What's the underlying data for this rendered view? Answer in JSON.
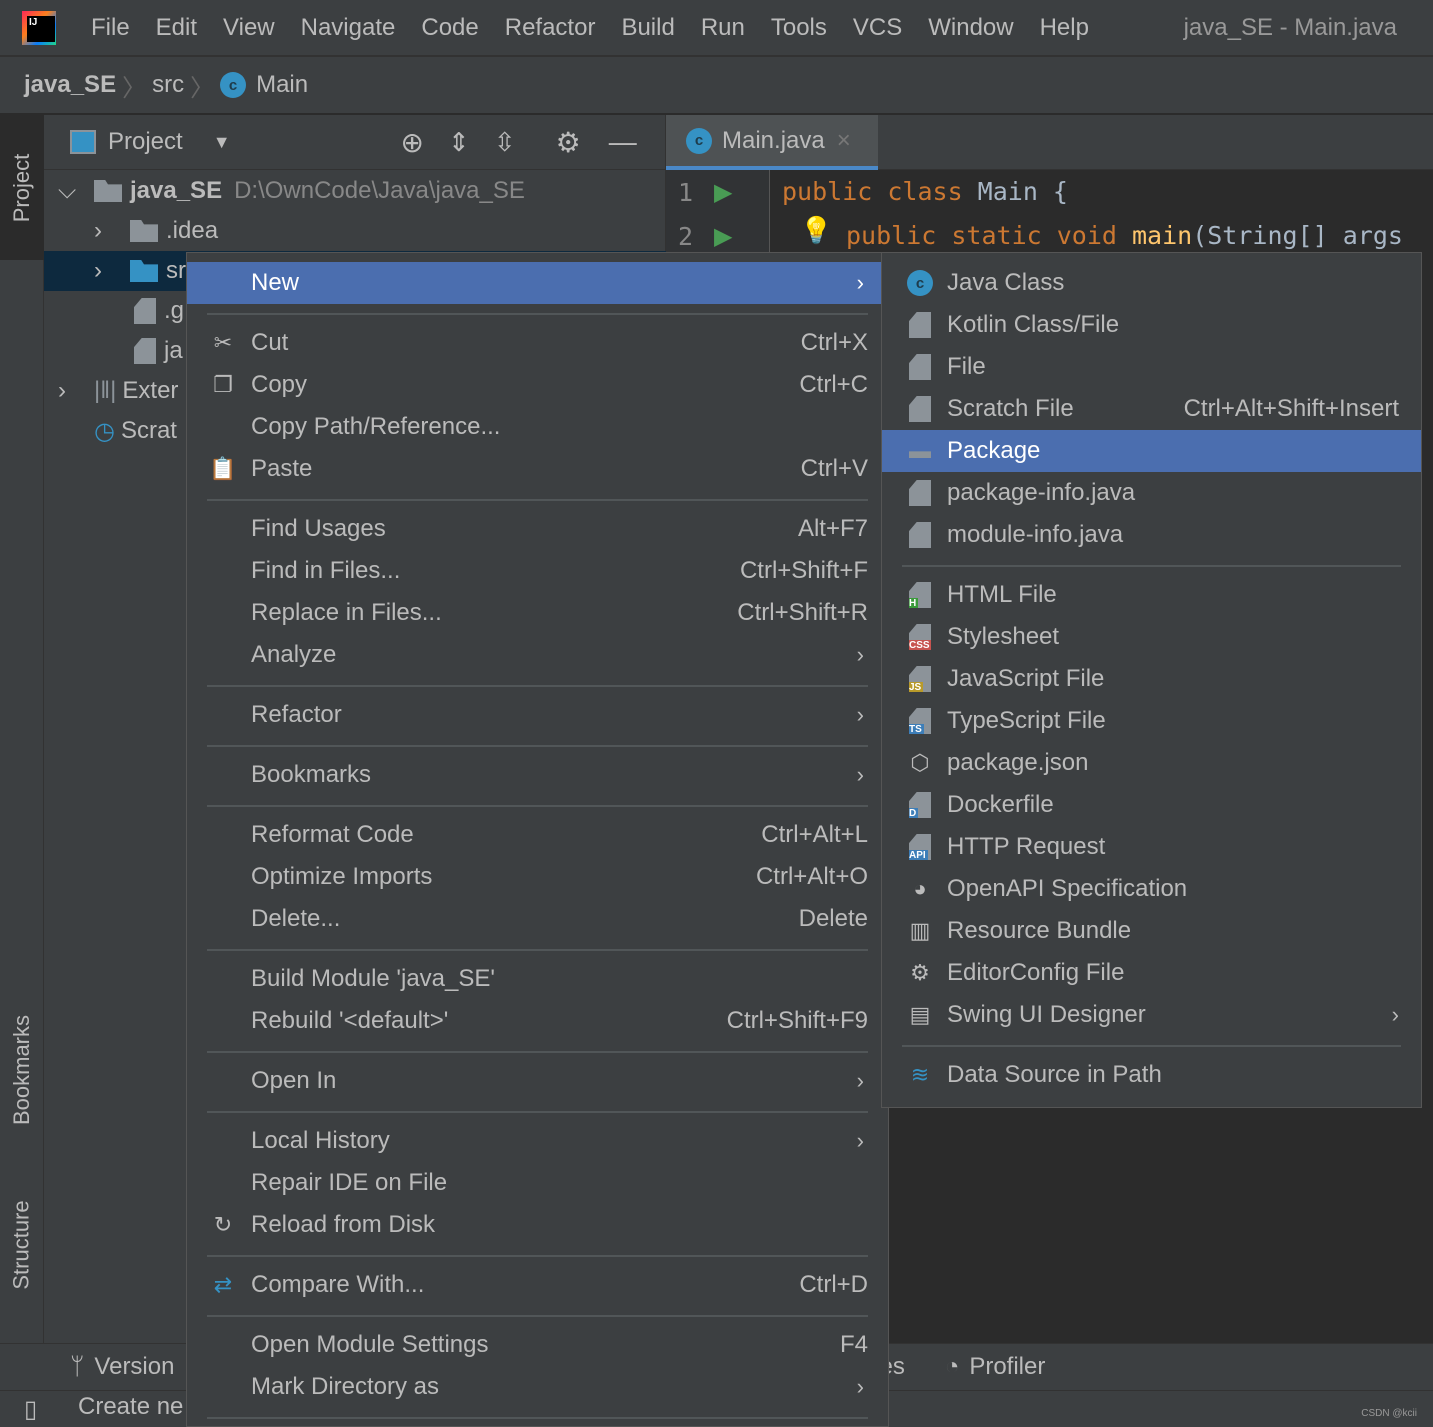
{
  "menubar": {
    "items": [
      {
        "label": "File",
        "m": 0
      },
      {
        "label": "Edit",
        "m": 0
      },
      {
        "label": "View",
        "m": 0
      },
      {
        "label": "Navigate",
        "m": 0
      },
      {
        "label": "Code",
        "m": 0
      },
      {
        "label": "Refactor",
        "m": 0
      },
      {
        "label": "Build",
        "m": 0
      },
      {
        "label": "Run",
        "m": 1
      },
      {
        "label": "Tools",
        "m": 0
      },
      {
        "label": "VCS",
        "m": 2
      },
      {
        "label": "Window",
        "m": 0
      },
      {
        "label": "Help",
        "m": 0
      }
    ],
    "window_title": "java_SE - Main.java"
  },
  "breadcrumb": [
    "java_SE",
    "src",
    "Main"
  ],
  "stripe": {
    "project": "Project",
    "bookmarks": "Bookmarks",
    "structure": "Structure"
  },
  "project_panel": {
    "title": "Project",
    "root": "java_SE",
    "root_path": "D:\\OwnCode\\Java\\java_SE",
    "rows": [
      ".idea",
      "sr",
      ".g",
      "ja",
      "Exter",
      "Scrat"
    ]
  },
  "editor": {
    "tab": "Main.java",
    "lines": [
      "1",
      "2"
    ],
    "code": {
      "l1": [
        "public ",
        "class ",
        "Main {"
      ],
      "l2": [
        "public ",
        "static ",
        "void ",
        "main",
        "(String[] args"
      ]
    }
  },
  "bottom": {
    "version": "Version",
    "problems": "es",
    "profiler": "Profiler",
    "status": "Create ne"
  },
  "context_menu": [
    {
      "label": "New",
      "m": 0,
      "arrow": true,
      "selected": true
    },
    {
      "sep": true
    },
    {
      "label": "Cut",
      "m": 2,
      "shortcut": "Ctrl+X",
      "icon": "scissors-icon"
    },
    {
      "label": "Copy",
      "m": 0,
      "shortcut": "Ctrl+C",
      "icon": "copy-icon"
    },
    {
      "label": "Copy Path/Reference..."
    },
    {
      "label": "Paste",
      "m": 0,
      "shortcut": "Ctrl+V",
      "icon": "clipboard-icon"
    },
    {
      "sep": true
    },
    {
      "label": "Find Usages",
      "m": 5,
      "shortcut": "Alt+F7"
    },
    {
      "label": "Find in Files...",
      "shortcut": "Ctrl+Shift+F"
    },
    {
      "label": "Replace in Files...",
      "m": 4,
      "shortcut": "Ctrl+Shift+R"
    },
    {
      "label": "Analyze",
      "m": 5,
      "arrow": true
    },
    {
      "sep": true
    },
    {
      "label": "Refactor",
      "m": 0,
      "arrow": true
    },
    {
      "sep": true
    },
    {
      "label": "Bookmarks",
      "arrow": true
    },
    {
      "sep": true
    },
    {
      "label": "Reformat Code",
      "m": 0,
      "shortcut": "Ctrl+Alt+L"
    },
    {
      "label": "Optimize Imports",
      "m": 6,
      "shortcut": "Ctrl+Alt+O"
    },
    {
      "label": "Delete...",
      "m": 0,
      "shortcut": "Delete"
    },
    {
      "sep": true
    },
    {
      "label": "Build Module 'java_SE'",
      "m": 6
    },
    {
      "label": "Rebuild '<default>'",
      "m": 2,
      "shortcut": "Ctrl+Shift+F9"
    },
    {
      "sep": true
    },
    {
      "label": "Open In",
      "arrow": true
    },
    {
      "sep": true
    },
    {
      "label": "Local History",
      "m": 6,
      "arrow": true
    },
    {
      "label": "Repair IDE on File"
    },
    {
      "label": "Reload from Disk",
      "icon": "reload-icon"
    },
    {
      "sep": true
    },
    {
      "label": "Compare With...",
      "shortcut": "Ctrl+D",
      "icon": "compare-icon"
    },
    {
      "sep": true
    },
    {
      "label": "Open Module Settings",
      "shortcut": "F4"
    },
    {
      "label": "Mark Directory as",
      "arrow": true
    },
    {
      "sep": true
    }
  ],
  "new_submenu": [
    {
      "label": "Java Class",
      "icon": "java-class-icon"
    },
    {
      "label": "Kotlin Class/File",
      "icon": "kotlin-file-icon"
    },
    {
      "label": "File",
      "icon": "file-icon"
    },
    {
      "label": "Scratch File",
      "shortcut": "Ctrl+Alt+Shift+Insert",
      "icon": "scratch-file-icon"
    },
    {
      "label": "Package",
      "icon": "package-icon",
      "selected": true
    },
    {
      "label": "package-info.java",
      "icon": "java-file-icon"
    },
    {
      "label": "module-info.java",
      "icon": "java-file-icon"
    },
    {
      "sep": true
    },
    {
      "label": "HTML File",
      "icon": "html-file-icon",
      "badge": "H",
      "color": "#3a9a3a"
    },
    {
      "label": "Stylesheet",
      "icon": "css-file-icon",
      "badge": "CSS",
      "color": "#c75450"
    },
    {
      "label": "JavaScript File",
      "icon": "js-file-icon",
      "badge": "JS",
      "color": "#b89a2a"
    },
    {
      "label": "TypeScript File",
      "icon": "ts-file-icon",
      "badge": "TS",
      "color": "#3d7eb8"
    },
    {
      "label": "package.json",
      "icon": "nodejs-icon"
    },
    {
      "label": "Dockerfile",
      "icon": "docker-file-icon",
      "badge": "D",
      "color": "#3d7eb8"
    },
    {
      "label": "HTTP Request",
      "icon": "http-request-icon",
      "badge": "API",
      "color": "#3d7eb8"
    },
    {
      "label": "OpenAPI Specification",
      "icon": "openapi-icon"
    },
    {
      "label": "Resource Bundle",
      "icon": "resource-bundle-icon"
    },
    {
      "label": "EditorConfig File",
      "icon": "gear-icon"
    },
    {
      "label": "Swing UI Designer",
      "icon": "swing-designer-icon",
      "arrow": true
    },
    {
      "sep": true
    },
    {
      "label": "Data Source in Path",
      "icon": "database-icon"
    }
  ],
  "colors": {
    "selection": "#4b6eaf",
    "keyword": "#cc7832",
    "method": "#ffc66d",
    "tree_selection": "#0d293e"
  },
  "watermark": "CSDN @kcii"
}
